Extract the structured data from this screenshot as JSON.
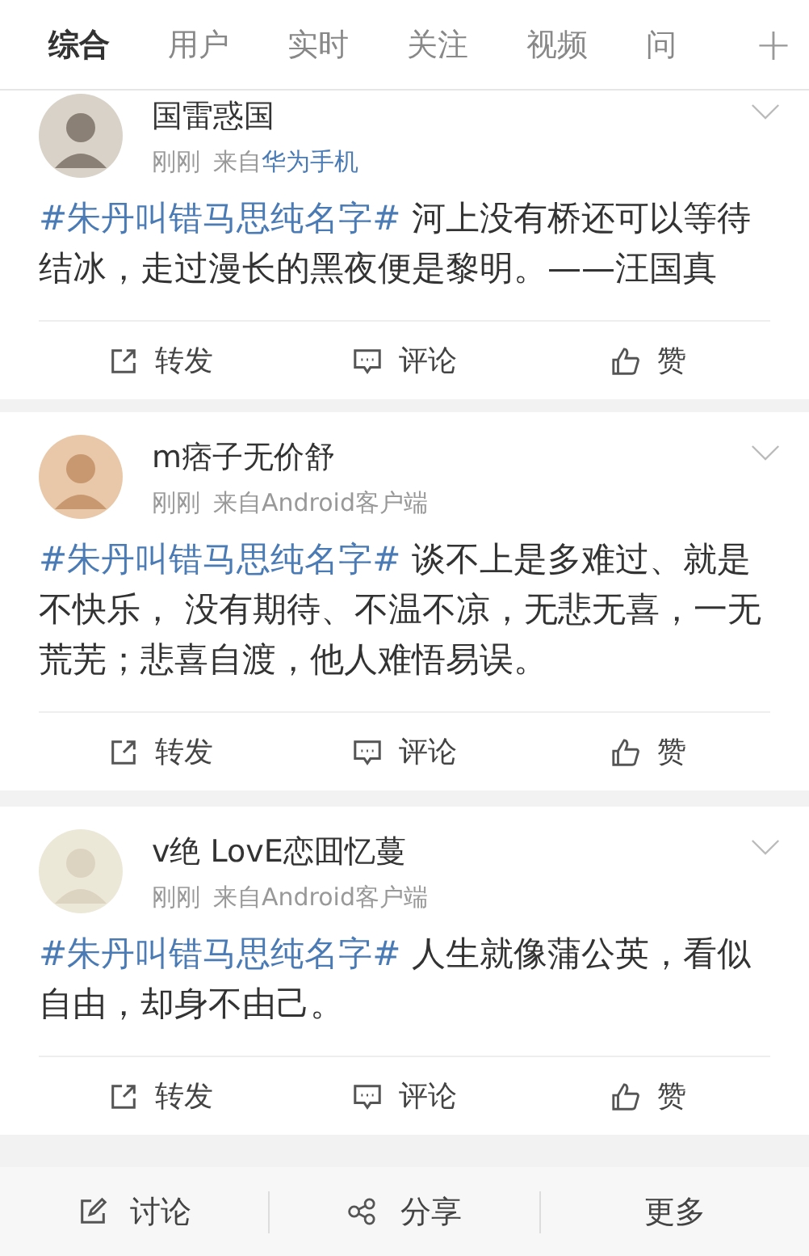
{
  "tabs": [
    {
      "label": "综合",
      "selected": true
    },
    {
      "label": "用户",
      "selected": false
    },
    {
      "label": "实时",
      "selected": false
    },
    {
      "label": "关注",
      "selected": false
    },
    {
      "label": "视频",
      "selected": false
    },
    {
      "label": "问",
      "selected": false
    }
  ],
  "add_tab": "+",
  "posts": [
    {
      "name": "国雷惑国",
      "time": "刚刚",
      "source_prefix": "来自",
      "source": "华为手机",
      "source_link": true,
      "topic": "#朱丹叫错马思纯名字#",
      "text": " 河上没有桥还可以等待结冰，走过漫长的黑夜便是黎明。——汪国真",
      "actions": [
        "转发",
        "评论",
        "赞"
      ]
    },
    {
      "name": "m痞子无价舒",
      "time": "刚刚",
      "source_prefix": "来自",
      "source": "Android客户端",
      "source_link": false,
      "topic": "#朱丹叫错马思纯名字#",
      "text": " 谈不上是多难过、就是不快乐， 没有期待、不温不凉，无悲无喜，一无荒芜；悲喜自渡，他人难悟易误。",
      "actions": [
        "转发",
        "评论",
        "赞"
      ]
    },
    {
      "name": "v绝 LovE恋囬忆蔓",
      "time": "刚刚",
      "source_prefix": "来自",
      "source": "Android客户端",
      "source_link": false,
      "topic": "#朱丹叫错马思纯名字#",
      "text": " 人生就像蒲公英，看似自由，却身不由己。",
      "actions": [
        "转发",
        "评论",
        "赞"
      ]
    }
  ],
  "bottom_bar": [
    "讨论",
    "分享",
    "更多"
  ]
}
